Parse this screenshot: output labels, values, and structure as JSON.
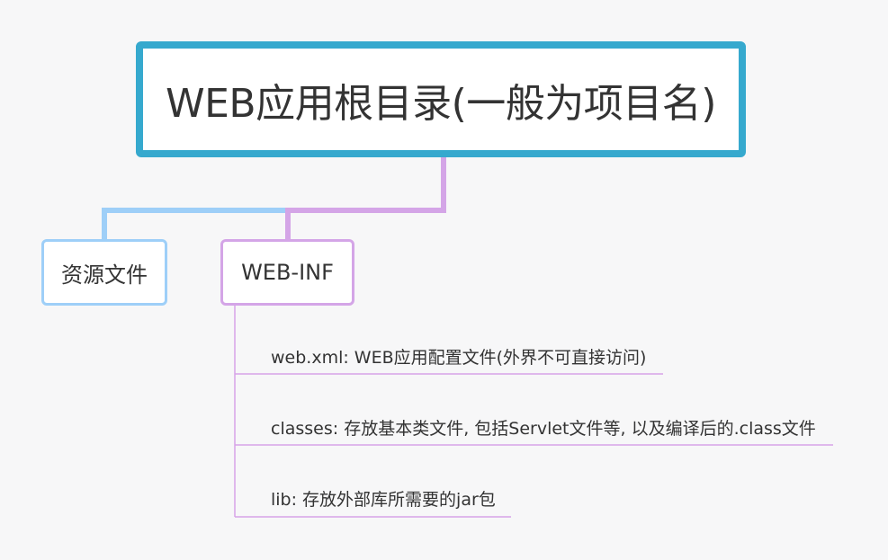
{
  "root": {
    "label": "WEB应用根目录(一般为项目名)"
  },
  "children": [
    {
      "label": "资源文件"
    },
    {
      "label": "WEB-INF"
    }
  ],
  "webinf_items": [
    {
      "text": "web.xml:  WEB应用配置文件(外界不可直接访问)"
    },
    {
      "text": "classes:  存放基本类文件, 包括Servlet文件等, 以及编译后的.class文件"
    },
    {
      "text": "lib:  存放外部库所需要的jar包"
    }
  ],
  "colors": {
    "root_border": "#36a9ce",
    "resource_branch": "#9ecff8",
    "webinf_branch": "#d4a5e7",
    "leaf_line": "#d7a4e8",
    "background": "#f7f7f8",
    "text": "#333333"
  }
}
